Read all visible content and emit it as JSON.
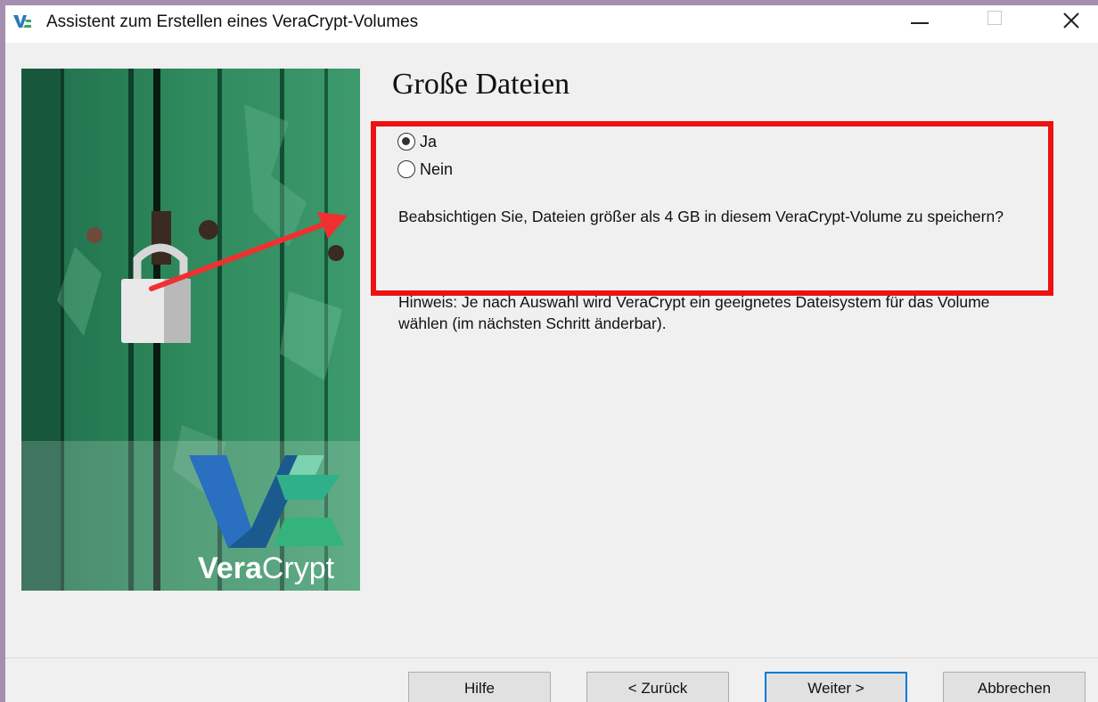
{
  "window": {
    "title": "Assistent zum Erstellen eines VeraCrypt-Volumes",
    "icon": "veracrypt-icon"
  },
  "sidebar_image": {
    "brand_text_bold": "Vera",
    "brand_text_regular": "Crypt"
  },
  "page": {
    "title": "Große Dateien",
    "options": [
      {
        "label": "Ja",
        "selected": true
      },
      {
        "label": "Nein",
        "selected": false
      }
    ],
    "question": "Beabsichtigen Sie, Dateien größer als 4 GB in diesem VeraCrypt-Volume zu speichern?",
    "hint": "Hinweis: Je nach Auswahl wird VeraCrypt ein geeignetes Dateisystem für das Volume wählen (im nächsten Schritt änderbar)."
  },
  "buttons": {
    "help": "Hilfe",
    "back": "< Zurück",
    "next": "Weiter >",
    "cancel": "Abbrechen"
  },
  "colors": {
    "annotation": "#ee1111",
    "default_button_border": "#0078d7"
  }
}
